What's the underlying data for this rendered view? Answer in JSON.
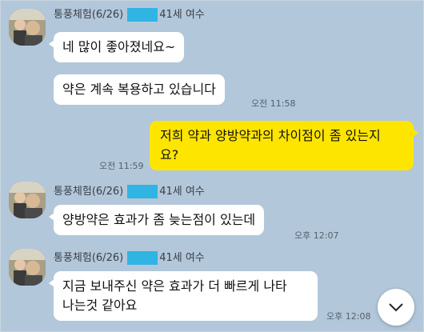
{
  "messages": [
    {
      "sender_prefix": "통풍체험(6/26)",
      "sender_suffix": "41세 여수"
    },
    {
      "text": "네 많이 좋아졌네요~"
    },
    {
      "text": "약은 계속 복용하고 있습니다",
      "time": "오전 11:58"
    },
    {
      "line1": "저희 약과 양방약과의 차이점이 좀 있는지",
      "line2": "요?",
      "time": "오전 11:59"
    },
    {
      "sender_prefix": "통풍체험(6/26)",
      "sender_suffix": "41세 여수"
    },
    {
      "text": "양방약은 효과가 좀 늦는점이 있는데",
      "time": "오후 12:07"
    },
    {
      "sender_prefix": "통풍체험(6/26)",
      "sender_suffix": "41세 여수"
    },
    {
      "line1": "지금 보내주신 약은 효과가 더 빠르게 나타",
      "line2": "나는것 같아요",
      "time": "오후 12:08"
    }
  ],
  "icons": {
    "scroll_down": "chevron-down-icon",
    "avatar": "avatar"
  },
  "colors": {
    "background": "#b2c7da",
    "my_bubble": "#fee500",
    "their_bubble": "#ffffff",
    "redaction": "#30b4e4"
  }
}
